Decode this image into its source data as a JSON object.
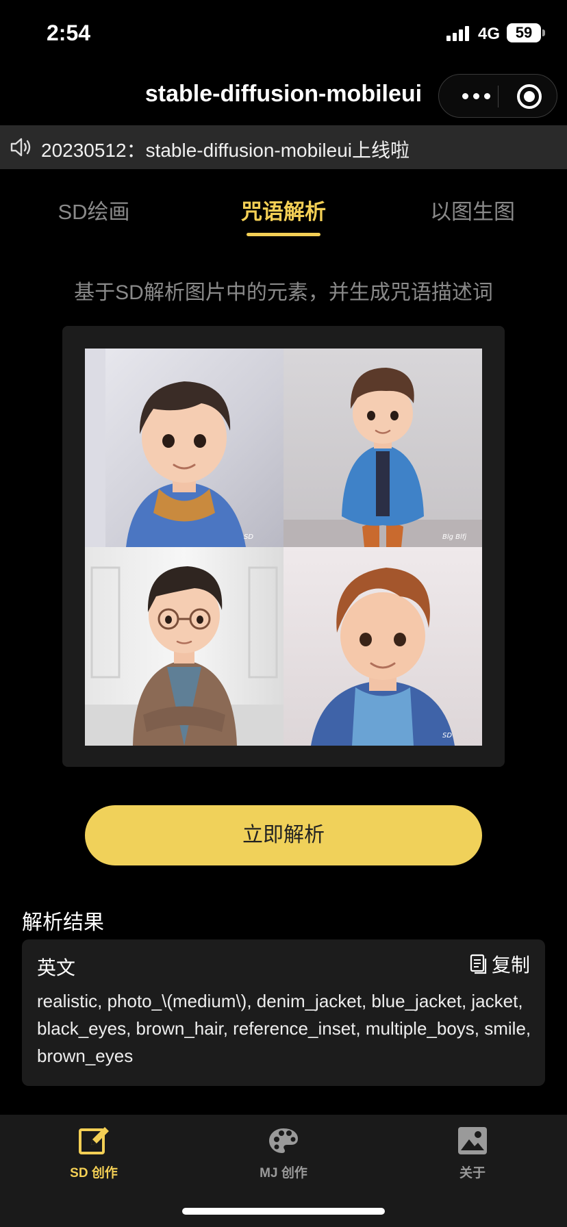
{
  "status_bar": {
    "time": "2:54",
    "network": "4G",
    "battery": "59"
  },
  "nav": {
    "title": "stable-diffusion-mobileui"
  },
  "notice": {
    "text": "20230512：stable-diffusion-mobileui上线啦"
  },
  "tabs": [
    {
      "label": "SD绘画",
      "active": false
    },
    {
      "label": "咒语解析",
      "active": true
    },
    {
      "label": "以图生图",
      "active": false
    }
  ],
  "description": "基于SD解析图片中的元素，并生成咒语描述词",
  "image": {
    "signatures": [
      "SD",
      "Blg Blfj",
      "",
      "SD"
    ]
  },
  "actions": {
    "analyze_label": "立即解析"
  },
  "result": {
    "title": "解析结果",
    "language_label": "英文",
    "copy_label": "复制",
    "text": "realistic, photo_\\(medium\\), denim_jacket, blue_jacket, jacket, black_eyes, brown_hair, reference_inset, multiple_boys, smile, brown_eyes"
  },
  "tabbar": [
    {
      "label": "SD 创作",
      "icon": "edit-icon",
      "active": true
    },
    {
      "label": "MJ 创作",
      "icon": "palette-icon",
      "active": false
    },
    {
      "label": "关于",
      "icon": "image-icon",
      "active": false
    }
  ],
  "colors": {
    "accent": "#f3cf55",
    "button": "#f0d15a",
    "card": "#1c1c1c",
    "background": "#000000"
  }
}
